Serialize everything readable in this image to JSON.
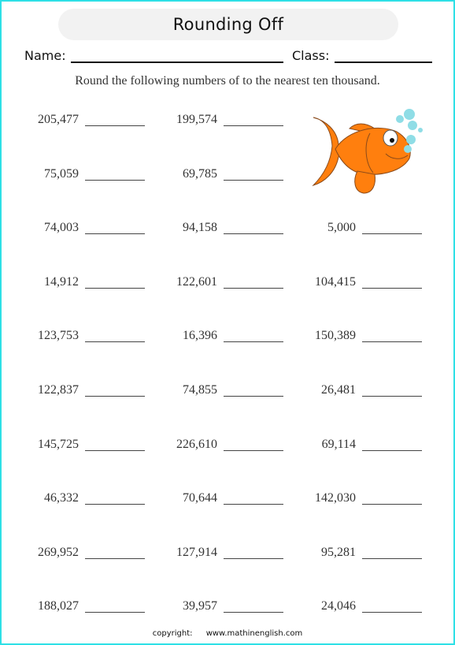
{
  "worksheet": {
    "title": "Rounding Off",
    "name_label": "Name:",
    "class_label": "Class:",
    "instruction": "Round the following numbers of to the nearest ten thousand.",
    "illustration": "goldfish-with-bubbles",
    "columns": [
      [
        "205,477",
        "75,059",
        "74,003",
        "14,912",
        "123,753",
        "122,837",
        "145,725",
        "46,332",
        "269,952",
        "188,027"
      ],
      [
        "199,574",
        "69,785",
        "94,158",
        "122,601",
        "16,396",
        "74,855",
        "226,610",
        "70,644",
        "127,914",
        "39,957"
      ],
      [
        null,
        null,
        "5,000",
        "104,415",
        "150,389",
        "26,481",
        "69,114",
        "142,030",
        "95,281",
        "24,046"
      ]
    ],
    "footer": {
      "copyright_label": "copyright:",
      "website": "www.mathinenglish.com"
    }
  },
  "colors": {
    "border": "#2ee0e6",
    "title_background": "#f2f2f2",
    "fish": "#ff7f0e",
    "bubbles": "#8fdde6"
  }
}
